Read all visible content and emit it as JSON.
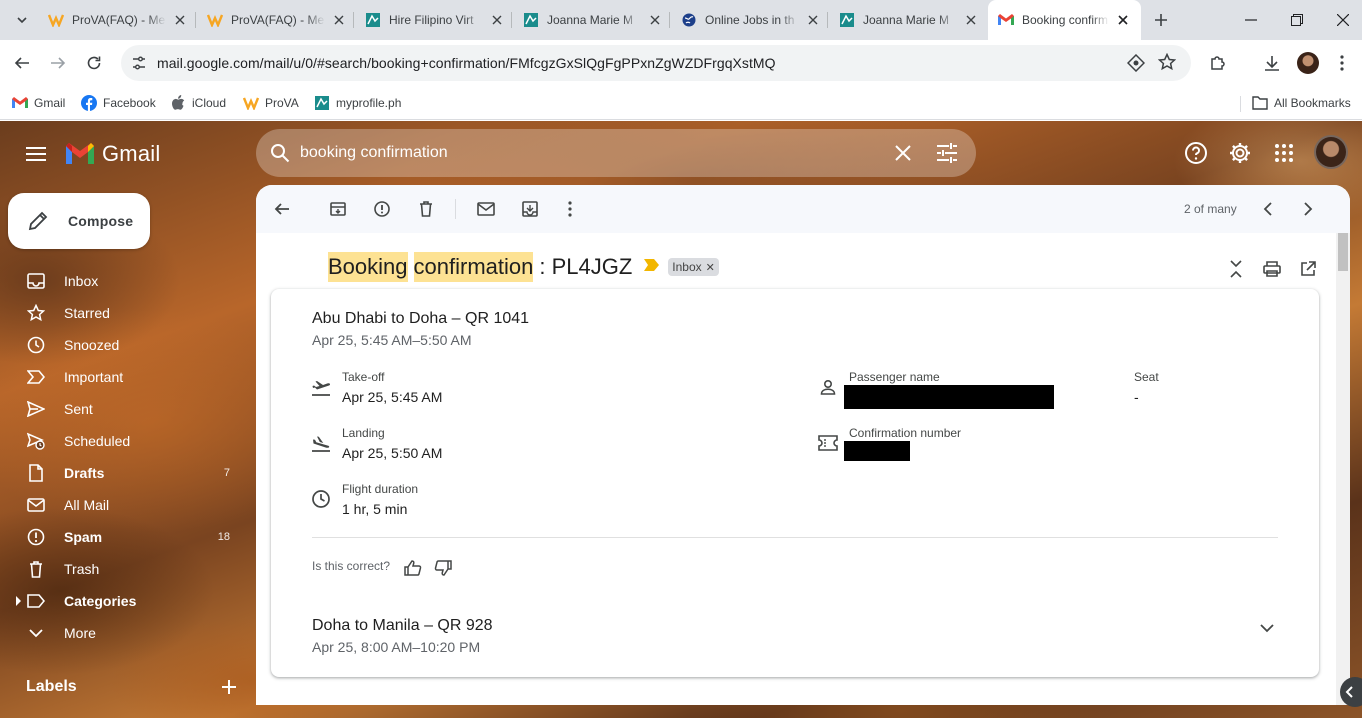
{
  "browser": {
    "tabs": [
      {
        "title": "ProVA(FAQ) - Me",
        "favicon": "prova-icon"
      },
      {
        "title": "ProVA(FAQ) - Me",
        "favicon": "prova-icon"
      },
      {
        "title": "Hire Filipino Virt",
        "favicon": "ojph-icon"
      },
      {
        "title": "Joanna Marie M",
        "favicon": "ojph-icon"
      },
      {
        "title": "Online Jobs in th",
        "favicon": "globe-icon"
      },
      {
        "title": "Joanna Marie M",
        "favicon": "ojph-icon"
      },
      {
        "title": "Booking confirm",
        "favicon": "gmail-icon",
        "active": true
      }
    ],
    "url": "mail.google.com/mail/u/0/#search/booking+confirmation/FMfcgzGxSlQgFgPPxnZgWZDFrgqXstMQ",
    "bookmarks": [
      {
        "label": "Gmail",
        "icon": "gmail-icon"
      },
      {
        "label": "Facebook",
        "icon": "facebook-icon"
      },
      {
        "label": "iCloud",
        "icon": "apple-icon"
      },
      {
        "label": "ProVA",
        "icon": "prova-icon"
      },
      {
        "label": "myprofile.ph",
        "icon": "ojph-icon"
      }
    ],
    "all_bookmarks": "All Bookmarks"
  },
  "gmail": {
    "logo_text": "Gmail",
    "search_value": "booking confirmation",
    "compose_label": "Compose",
    "nav": [
      {
        "label": "Inbox",
        "icon": "inbox-icon",
        "count": ""
      },
      {
        "label": "Starred",
        "icon": "star-icon",
        "count": ""
      },
      {
        "label": "Snoozed",
        "icon": "clock-icon",
        "count": ""
      },
      {
        "label": "Important",
        "icon": "important-icon",
        "count": ""
      },
      {
        "label": "Sent",
        "icon": "send-icon",
        "count": ""
      },
      {
        "label": "Scheduled",
        "icon": "scheduled-icon",
        "count": ""
      },
      {
        "label": "Drafts",
        "icon": "draft-icon",
        "count": "7",
        "bold": true
      },
      {
        "label": "All Mail",
        "icon": "mail-icon",
        "count": ""
      },
      {
        "label": "Spam",
        "icon": "spam-icon",
        "count": "18",
        "bold": true
      },
      {
        "label": "Trash",
        "icon": "trash-icon",
        "count": ""
      },
      {
        "label": "Categories",
        "icon": "label-icon",
        "count": "",
        "bold": true
      },
      {
        "label": "More",
        "icon": "chevron-down-icon",
        "count": ""
      }
    ],
    "labels_heading": "Labels",
    "pager": "2 of many",
    "email": {
      "subject_hl1": "Booking",
      "subject_hl2": "confirmation",
      "subject_rest": ": PL4JGZ",
      "inbox_chip": "Inbox",
      "flight1": {
        "title": "Abu Dhabi to Doha – QR 1041",
        "time": "Apr 25, 5:45 AM–5:50 AM",
        "takeoff_label": "Take-off",
        "takeoff_value": "Apr 25, 5:45 AM",
        "landing_label": "Landing",
        "landing_value": "Apr 25, 5:50 AM",
        "duration_label": "Flight duration",
        "duration_value": "1 hr, 5 min",
        "passenger_label": "Passenger name",
        "seat_label": "Seat",
        "seat_value": "-",
        "confirmation_label": "Confirmation number"
      },
      "feedback_question": "Is this correct?",
      "flight2": {
        "title": "Doha to Manila – QR 928",
        "time": "Apr 25, 8:00 AM–10:20 PM"
      }
    }
  },
  "colors": {
    "highlight": "#fde293",
    "gmail_red": "#ea4335",
    "important": "#f2b600"
  }
}
